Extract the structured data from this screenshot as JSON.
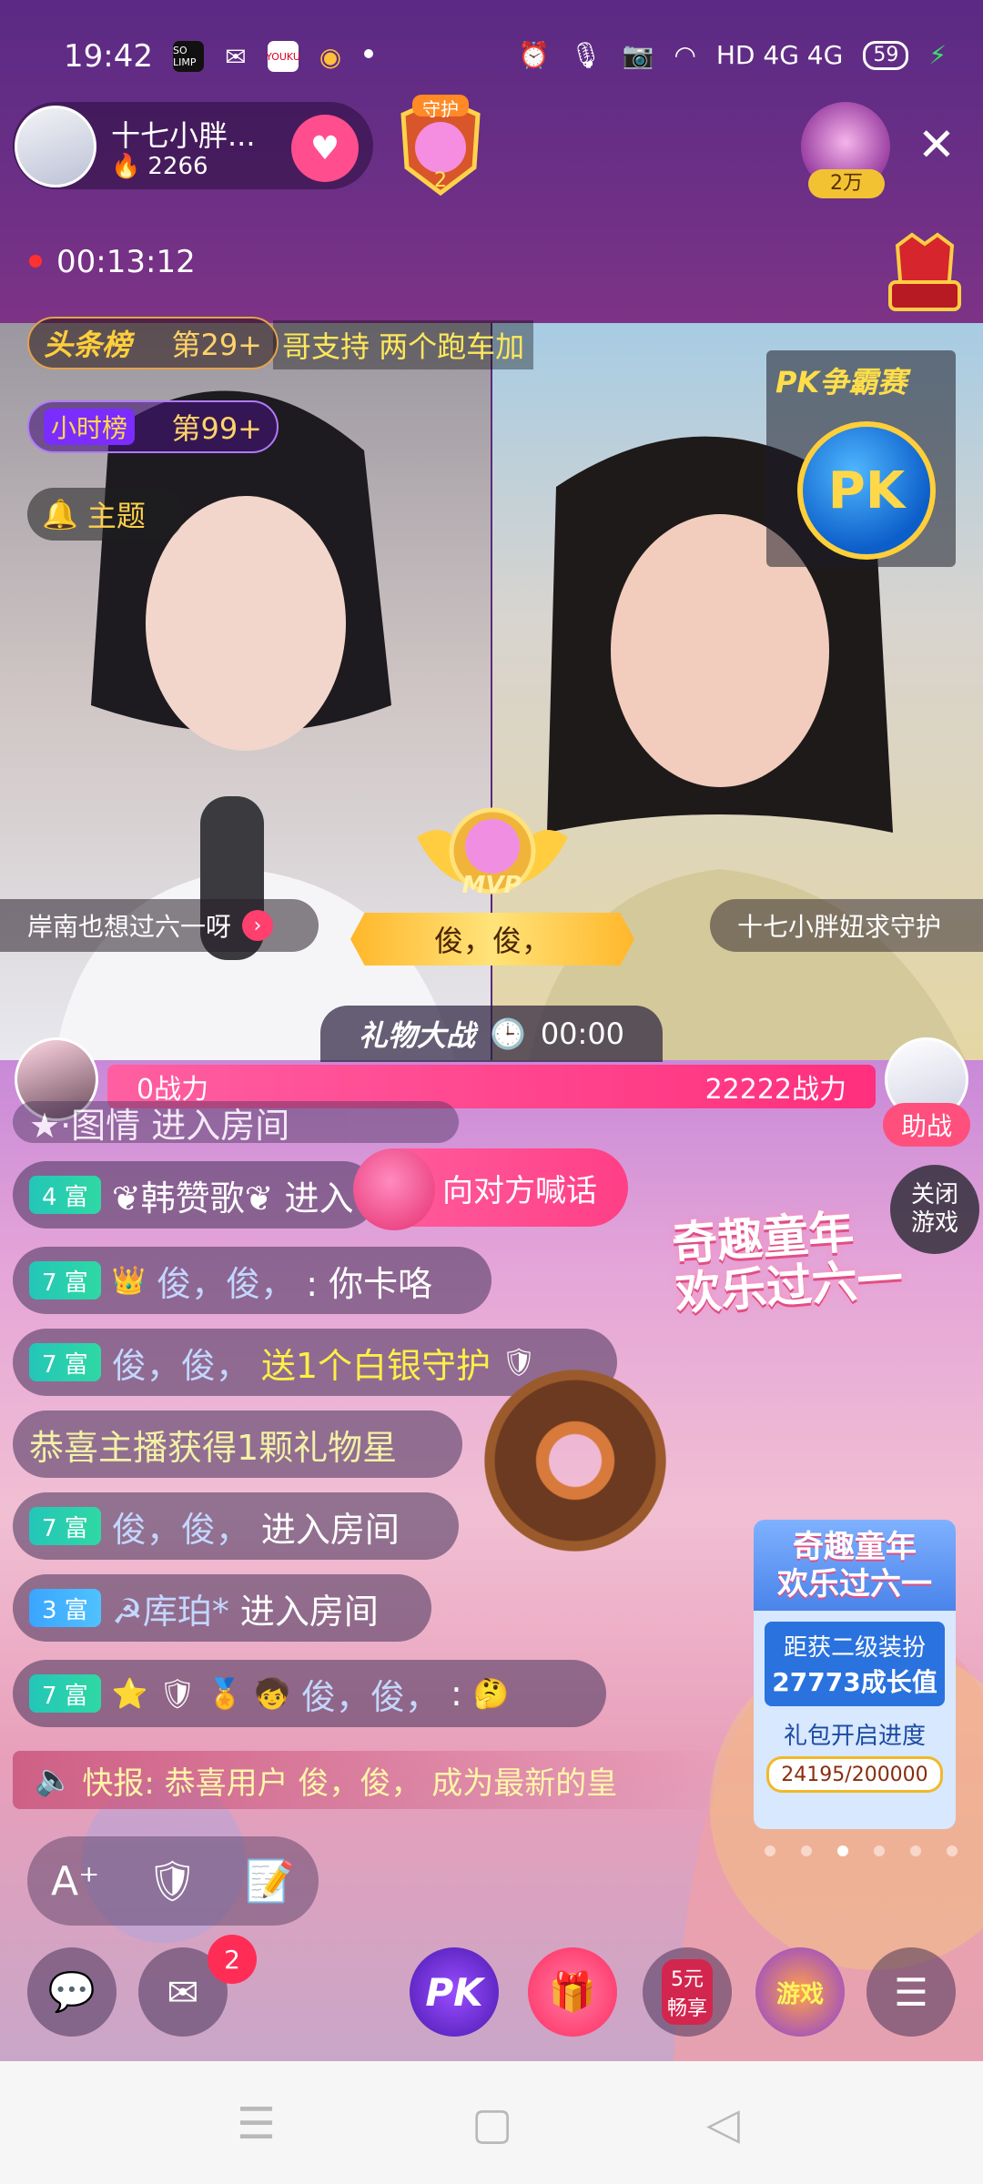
{
  "status_bar": {
    "time": "19:42",
    "apps": [
      "SO LIMP",
      "WeChat",
      "YOUKU",
      "Weibo"
    ],
    "network": "HD 4G 4G",
    "battery": "59"
  },
  "host": {
    "name": "十七小胖...",
    "heat": "2266"
  },
  "guard_badge_level": "2",
  "guard_badge_label": "守护",
  "top_gift_count": "2万",
  "timer": "00:13:12",
  "left_video": {
    "rank1_label": "头条榜",
    "rank1_value": "第29+",
    "rank2_label": "小时榜",
    "rank2_value": "第99+",
    "theme_label": "主题",
    "ticker_text": "哥支持 两个跑车加",
    "streamer_tag": "岸南也想过六一呀"
  },
  "right_video": {
    "pk_contest_label": "PK争霸赛",
    "pk_ball_label": "PK",
    "streamer_tag": "十七小胖妞求守护"
  },
  "mvp": {
    "label": "MVP",
    "name": "俊，俊，"
  },
  "gift_war": {
    "title": "礼物大战",
    "countdown": "00:00"
  },
  "power": {
    "left": "0战力",
    "right": "22222战力",
    "assist_label": "助战"
  },
  "shout_label": "向对方喊话",
  "close_game_label": "关闭\n游戏",
  "chat": {
    "partial": "★·图情 进入房间",
    "rows": [
      {
        "level": "4 富",
        "user": "❦韩赞歌❦",
        "text": "进入"
      },
      {
        "level": "7 富",
        "user": "俊，俊，",
        "text": ": 你卡咯"
      },
      {
        "level": "7 富",
        "user": "俊，俊，",
        "text": "送1个白银守护"
      },
      {
        "level": "",
        "user": "",
        "text": "恭喜主播获得1颗礼物星"
      },
      {
        "level": "7 富",
        "user": "俊，俊，",
        "text": "进入房间"
      },
      {
        "level": "3 富",
        "user": "☭库珀*",
        "text": "进入房间"
      },
      {
        "level": "7 富",
        "user": "俊，俊，",
        "text": ":"
      }
    ],
    "flash": "快报: 恭喜用户 俊，俊， 成为最新的皇"
  },
  "event": {
    "banner": "奇趣童年\n欢乐过六一",
    "panel_title": "奇趣童年\n欢乐过六一",
    "level_label": "距获二级装扮",
    "level_value": "27773成长值",
    "progress_label": "礼包开启进度",
    "progress_value": "24195/200000",
    "progress_fraction": 0.121
  },
  "bottom_bar": {
    "message_badge": "2",
    "pk_label": "PK",
    "promo_label": "5元\n畅享",
    "game_label": "游戏"
  },
  "colors": {
    "accent_pink": "#ff3f86",
    "gold": "#ffef46",
    "rich_tag": "#23c6b8"
  }
}
